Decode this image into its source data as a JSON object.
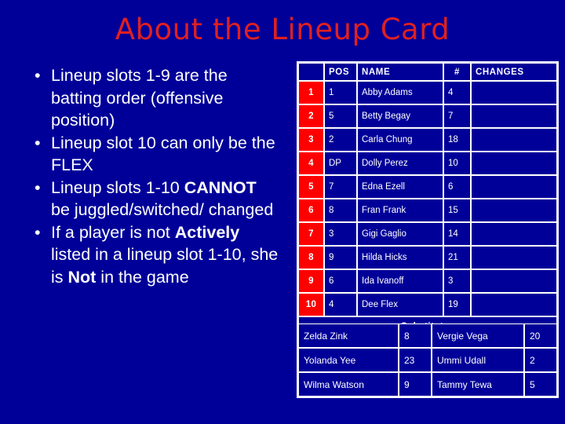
{
  "slide": {
    "title": "About the Lineup Card",
    "background_color": "#000099",
    "title_color": "#E02020",
    "accent_color": "#FF0000"
  },
  "bullets": [
    {
      "dot": "•",
      "html": "Lineup slots 1-9 are the batting order (offensive position)"
    },
    {
      "dot": "•",
      "html": "Lineup slot 10 can only be the FLEX"
    },
    {
      "dot": "•",
      "html": "Lineup slots 1-10 <b>CANNOT</b> be juggled/switched/ changed"
    },
    {
      "dot": "•",
      "html": "If a player is not <b>Actively</b> listed in a lineup slot 1-10, she is <b>Not</b> in the game"
    }
  ],
  "lineup": {
    "headers": [
      "",
      "POS",
      "NAME",
      "#",
      "CHANGES"
    ],
    "rows": [
      {
        "slot": "1",
        "pos": "1",
        "name": "Abby Adams",
        "num": "4",
        "changes": ""
      },
      {
        "slot": "2",
        "pos": "5",
        "name": "Betty Begay",
        "num": "7",
        "changes": ""
      },
      {
        "slot": "3",
        "pos": "2",
        "name": "Carla Chung",
        "num": "18",
        "changes": ""
      },
      {
        "slot": "4",
        "pos": "DP",
        "name": "Dolly Perez",
        "num": "10",
        "changes": ""
      },
      {
        "slot": "5",
        "pos": "7",
        "name": "Edna Ezell",
        "num": "6",
        "changes": ""
      },
      {
        "slot": "6",
        "pos": "8",
        "name": "Fran Frank",
        "num": "15",
        "changes": ""
      },
      {
        "slot": "7",
        "pos": "3",
        "name": "Gigi Gaglio",
        "num": "14",
        "changes": ""
      },
      {
        "slot": "8",
        "pos": "9",
        "name": "Hilda Hicks",
        "num": "21",
        "changes": ""
      },
      {
        "slot": "9",
        "pos": "6",
        "name": "Ida Ivanoff",
        "num": "3",
        "changes": ""
      },
      {
        "slot": "10",
        "pos": "4",
        "name": "Dee Flex",
        "num": "19",
        "changes": ""
      }
    ],
    "substitutes_label": "Substitutes"
  },
  "substitutes": [
    {
      "name1": "Zelda Zink",
      "num1": "8",
      "name2": "Vergie Vega",
      "num2": "20"
    },
    {
      "name1": "Yolanda Yee",
      "num1": "23",
      "name2": "Ummi Udall",
      "num2": "2"
    },
    {
      "name1": "Wilma Watson",
      "num1": "9",
      "name2": "Tammy Tewa",
      "num2": "5"
    }
  ]
}
